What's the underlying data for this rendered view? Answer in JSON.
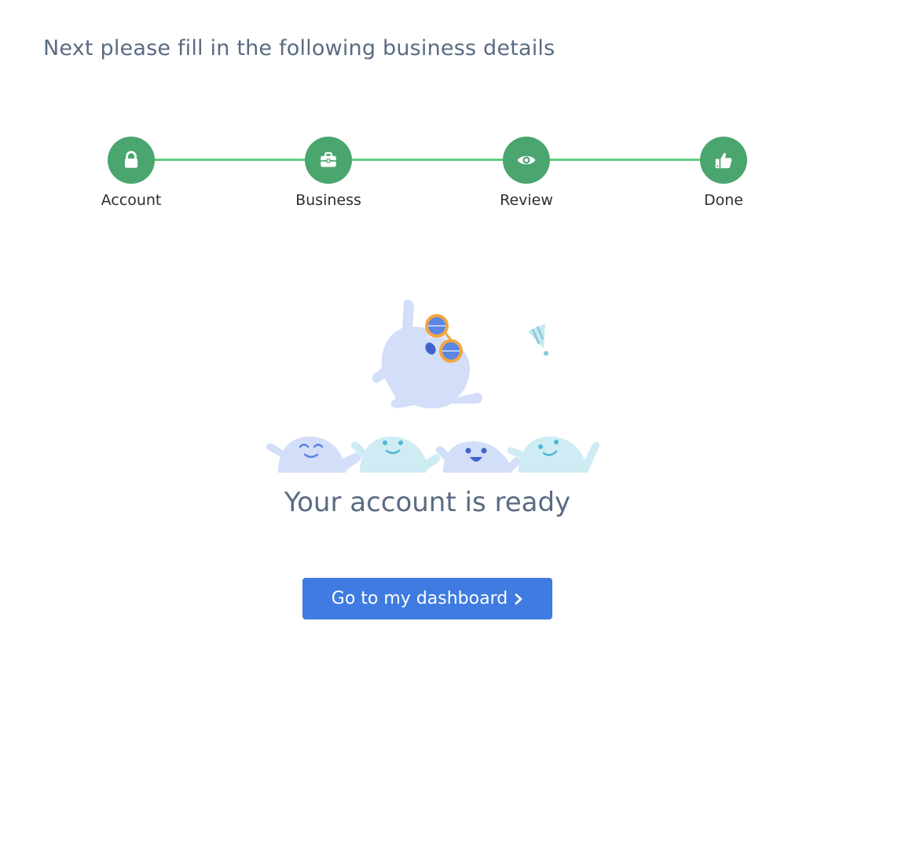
{
  "page": {
    "heading": "Next please fill in the following business details"
  },
  "stepper": {
    "steps": [
      {
        "label": "Account",
        "icon": "lock-icon"
      },
      {
        "label": "Business",
        "icon": "briefcase-icon"
      },
      {
        "label": "Review",
        "icon": "eye-icon"
      },
      {
        "label": "Done",
        "icon": "thumbs-up-icon"
      }
    ],
    "colors": {
      "circle": "#4aa56e",
      "line": "#5fcf7e"
    }
  },
  "completion": {
    "title": "Your account is ready",
    "button_label": "Go to my dashboard",
    "button_icon": "chevron-right-icon",
    "button_color": "#3f7be0"
  }
}
